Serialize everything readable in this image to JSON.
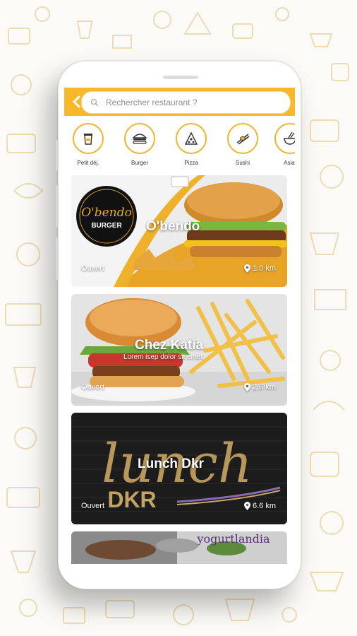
{
  "search": {
    "placeholder": "Rechercher restaurant ?"
  },
  "categories": [
    {
      "label": "Petit déj.",
      "icon": "coffee-cup-icon"
    },
    {
      "label": "Burger",
      "icon": "burger-icon"
    },
    {
      "label": "Pizza",
      "icon": "pizza-icon"
    },
    {
      "label": "Sushi",
      "icon": "sushi-chopsticks-icon"
    },
    {
      "label": "Asiat",
      "icon": "noodle-bowl-icon"
    }
  ],
  "restaurants": [
    {
      "name": "O'bendo",
      "subtitle": "",
      "status": "Ouvert",
      "distance": "1.0 km",
      "logo_text": "O'bendo",
      "logo_sub": "BURGER"
    },
    {
      "name": "Chez Katia",
      "subtitle": "Lorem isep dolor sit emet",
      "status": "Ouvert",
      "distance": "2.6 km"
    },
    {
      "name": "Lunch Dkr",
      "subtitle": "",
      "status": "Ouvert",
      "distance": "6.6 km",
      "sign_script": "lunch",
      "sign_caps": "DKR"
    },
    {
      "name": "",
      "sign_text": "yogurtlandia"
    }
  ],
  "colors": {
    "accent": "#f7b829",
    "page_background": "#fbfaf6",
    "doodle": "#ecdcb6"
  }
}
